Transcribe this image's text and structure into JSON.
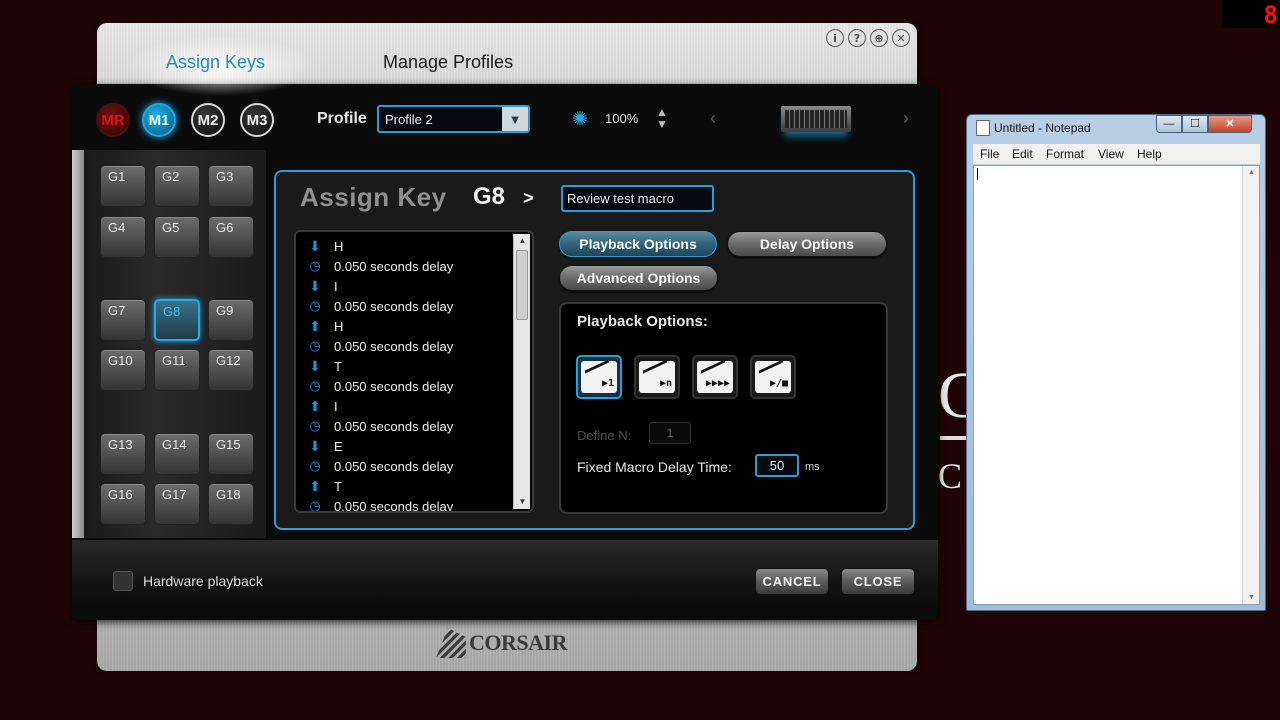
{
  "corner_indicator": "8",
  "app": {
    "tabs": {
      "assign": "Assign Keys",
      "manage": "Manage Profiles"
    },
    "window_icons": [
      "i",
      "?",
      "⊕",
      "✕"
    ],
    "modes": [
      "MR",
      "M1",
      "M2",
      "M3"
    ],
    "profile_label": "Profile",
    "profile_value": "Profile 2",
    "brightness": "100%",
    "gkeys": [
      "G1",
      "G2",
      "G3",
      "G4",
      "G5",
      "G6",
      "G7",
      "G8",
      "G9",
      "G10",
      "G11",
      "G12",
      "G13",
      "G14",
      "G15",
      "G16",
      "G17",
      "G18"
    ],
    "selected_gkey": "G8",
    "assign_title": "Assign Key",
    "assign_key": "G8",
    "assign_arrow": ">",
    "macro_name": "Review test macro",
    "macro_steps": [
      {
        "icon": "down-arrow-icon",
        "text": "H"
      },
      {
        "icon": "clock-icon",
        "text": "0.050 seconds delay"
      },
      {
        "icon": "down-arrow-icon",
        "text": "I"
      },
      {
        "icon": "clock-icon",
        "text": "0.050 seconds delay"
      },
      {
        "icon": "up-arrow-icon",
        "text": "H"
      },
      {
        "icon": "clock-icon",
        "text": "0.050 seconds delay"
      },
      {
        "icon": "down-arrow-icon",
        "text": "T"
      },
      {
        "icon": "clock-icon",
        "text": "0.050 seconds delay"
      },
      {
        "icon": "up-arrow-icon",
        "text": "I"
      },
      {
        "icon": "clock-icon",
        "text": "0.050 seconds delay"
      },
      {
        "icon": "down-arrow-icon",
        "text": "E"
      },
      {
        "icon": "clock-icon",
        "text": "0.050 seconds delay"
      },
      {
        "icon": "up-arrow-icon",
        "text": "T"
      },
      {
        "icon": "clock-icon",
        "text": "0.050 seconds delay"
      }
    ],
    "option_buttons": {
      "playback": "Playback Options",
      "delay": "Delay Options",
      "advanced": "Advanced Options"
    },
    "playback_title": "Playback Options:",
    "playback_modes": [
      "▶1",
      "▶n",
      "▶▶▶▶",
      "▶/■"
    ],
    "define_n_label": "Define N:",
    "define_n_value": "1",
    "fixed_delay_label": "Fixed Macro Delay Time:",
    "fixed_delay_value": "50",
    "fixed_delay_unit": "ms",
    "hardware_playback_label": "Hardware playback",
    "cancel_label": "CANCEL",
    "close_label": "CLOSE",
    "brand": "CORSAIR",
    "accent_color": "#2aa0d6"
  },
  "background_text": {
    "large": "C",
    "small": "C"
  },
  "notepad": {
    "title": "Untitled - Notepad",
    "controls": {
      "min": "—",
      "max": "☐",
      "close": "✕"
    },
    "menu": [
      "File",
      "Edit",
      "Format",
      "View",
      "Help"
    ]
  }
}
